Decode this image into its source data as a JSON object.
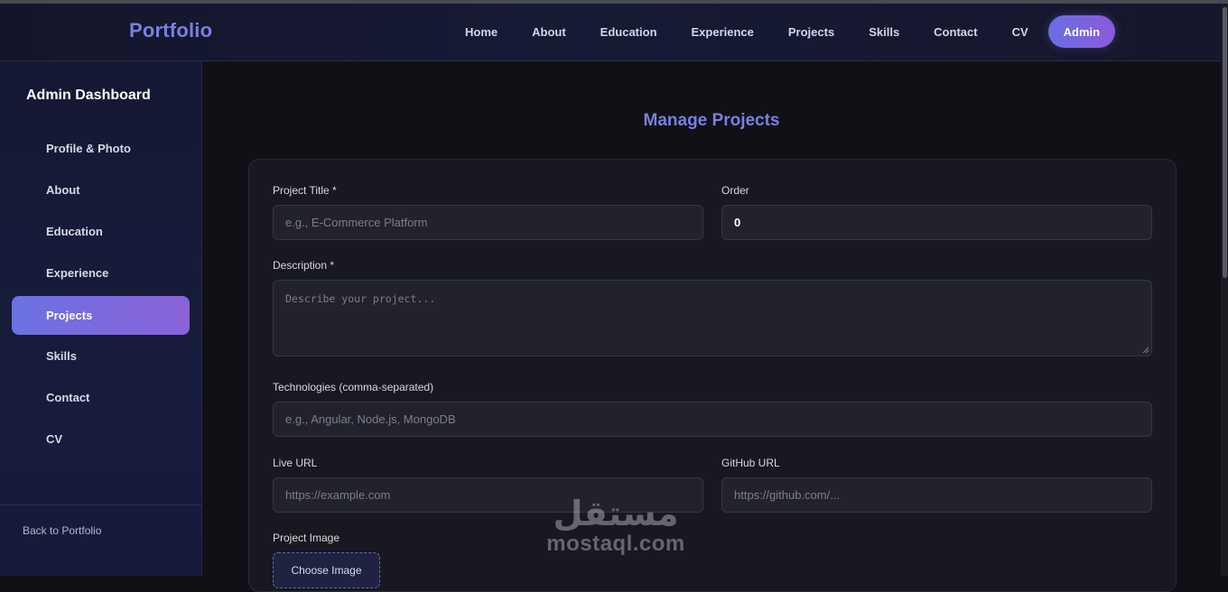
{
  "nav": {
    "brand": "Portfolio",
    "links": [
      "Home",
      "About",
      "Education",
      "Experience",
      "Projects",
      "Skills",
      "Contact",
      "CV"
    ],
    "admin": "Admin"
  },
  "sidebar": {
    "title": "Admin Dashboard",
    "items": [
      {
        "label": "Profile & Photo"
      },
      {
        "label": "About"
      },
      {
        "label": "Education"
      },
      {
        "label": "Experience"
      },
      {
        "label": "Projects",
        "active": true
      },
      {
        "label": "Skills"
      },
      {
        "label": "Contact"
      },
      {
        "label": "CV"
      }
    ],
    "back_label": "Back to Portfolio"
  },
  "main": {
    "title": "Manage Projects",
    "form": {
      "project_title": {
        "label": "Project Title *",
        "placeholder": "e.g., E-Commerce Platform",
        "value": ""
      },
      "order": {
        "label": "Order",
        "value": "0"
      },
      "description": {
        "label": "Description *",
        "placeholder": "Describe your project..."
      },
      "technologies": {
        "label": "Technologies (comma-separated)",
        "placeholder": "e.g., Angular, Node.js, MongoDB"
      },
      "live_url": {
        "label": "Live URL",
        "placeholder": "https://example.com"
      },
      "github_url": {
        "label": "GitHub URL",
        "placeholder": "https://github.com/..."
      },
      "project_image": {
        "label": "Project Image",
        "button": "Choose Image"
      }
    }
  },
  "watermark": {
    "arabic": "مستقل",
    "latin": "mostaql.com"
  },
  "colors": {
    "accent": "#7b7fe0",
    "active_gradient_start": "#6a72e2",
    "active_gradient_end": "#8a62d8",
    "background": "#101016"
  }
}
